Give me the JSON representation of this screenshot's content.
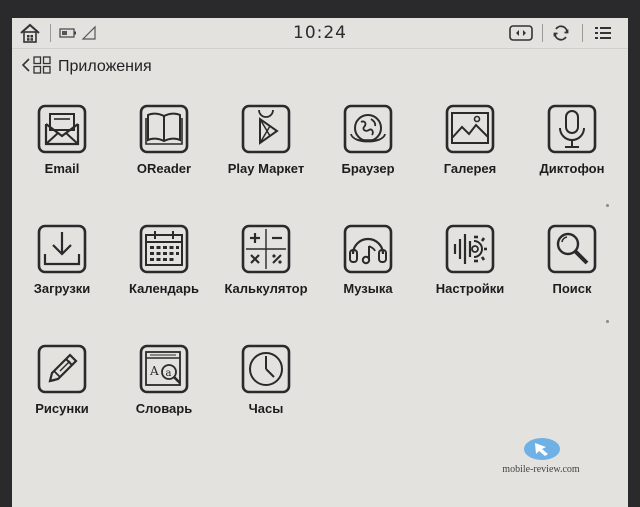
{
  "statusbar": {
    "time": "10:24",
    "icons": [
      "home-icon",
      "battery-icon",
      "wifi-signal-icon",
      "full-refresh-icon",
      "sync-icon",
      "menu-icon"
    ]
  },
  "titlebar": {
    "title": "Приложения",
    "icons": [
      "back-chevron-icon",
      "app-grid-icon"
    ]
  },
  "apps": [
    {
      "label": "Email",
      "icon": "email-icon"
    },
    {
      "label": "OReader",
      "icon": "book-icon"
    },
    {
      "label": "Play Маркет",
      "icon": "play-store-icon"
    },
    {
      "label": "Браузер",
      "icon": "browser-globe-icon"
    },
    {
      "label": "Галерея",
      "icon": "gallery-icon"
    },
    {
      "label": "Диктофон",
      "icon": "microphone-icon"
    },
    {
      "label": "Загрузки",
      "icon": "download-icon"
    },
    {
      "label": "Календарь",
      "icon": "calendar-icon"
    },
    {
      "label": "Калькулятор",
      "icon": "calculator-icon"
    },
    {
      "label": "Музыка",
      "icon": "headphones-icon"
    },
    {
      "label": "Настройки",
      "icon": "settings-gear-icon"
    },
    {
      "label": "Поиск",
      "icon": "search-icon"
    },
    {
      "label": "Рисунки",
      "icon": "pencil-icon"
    },
    {
      "label": "Словарь",
      "icon": "dictionary-icon"
    },
    {
      "label": "Часы",
      "icon": "clock-icon"
    }
  ],
  "watermark": {
    "text": "mobile-review.com",
    "icon": "logo-icon"
  }
}
